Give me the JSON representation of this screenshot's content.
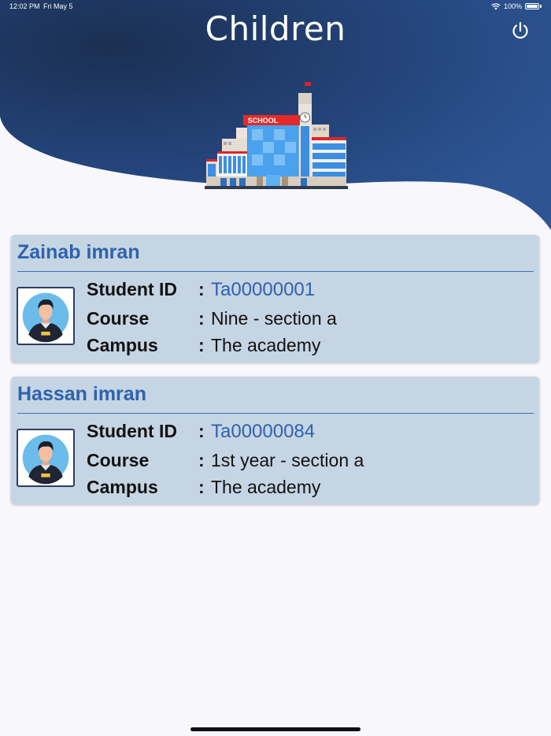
{
  "status_bar": {
    "time": "12:02 PM",
    "date": "Fri May 5",
    "battery": "100%"
  },
  "header": {
    "title": "Children",
    "power_icon": "power-icon",
    "gradient_dark": "#1d3a6b",
    "gradient_light": "#2f5a9c"
  },
  "illustration": {
    "sign_text": "SCHOOL"
  },
  "children": [
    {
      "name": "Zainab imran",
      "labels": {
        "student_id": "Student ID",
        "course": "Course",
        "campus": "Campus"
      },
      "colon": ":",
      "student_id": "Ta00000001",
      "course": "Nine - section a",
      "campus": "The academy"
    },
    {
      "name": "Hassan imran",
      "labels": {
        "student_id": "Student ID",
        "course": "Course",
        "campus": "Campus"
      },
      "colon": ":",
      "student_id": "Ta00000084",
      "course": "1st year - section a",
      "campus": "The academy"
    }
  ],
  "colors": {
    "accent": "#2f62ad",
    "card_bg": "#c5d5e4",
    "page_bg": "#f8f7fc"
  }
}
